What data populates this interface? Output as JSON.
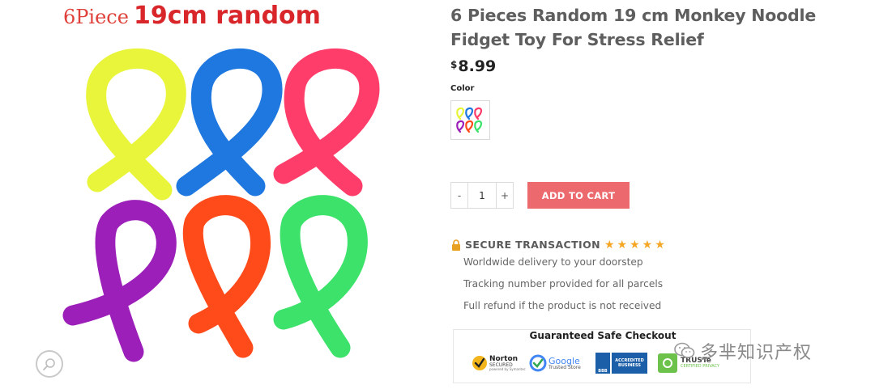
{
  "image": {
    "caption_count": "6Piece",
    "caption_size": "19cm random",
    "noodle_colors": [
      "#e8f53a",
      "#1f78e0",
      "#ff3d6a",
      "#9b1fb8",
      "#ff4a1a",
      "#3ce26a"
    ]
  },
  "product": {
    "title": "6 Pieces Random 19 cm Monkey Noodle Fidget Toy For Stress Relief",
    "currency": "$",
    "price": "8.99",
    "color_label": "Color"
  },
  "cart": {
    "minus": "-",
    "quantity": "1",
    "plus": "+",
    "add_label": "ADD TO CART"
  },
  "secure": {
    "label": "SECURE TRANSACTION",
    "stars": 5,
    "features": [
      "Worldwide delivery to your doorstep",
      "Tracking number provided for all parcels",
      "Full refund if the product is not received"
    ]
  },
  "checkout": {
    "title": "Guaranteed Safe Checkout",
    "norton_line1": "Norton",
    "norton_line2": "SECURED",
    "norton_line3": "powered by Symantec",
    "google_line1": "Google",
    "google_line2": "Trusted Store",
    "bbb_line1": "ACCREDITED",
    "bbb_line2": "BUSINESS",
    "bbb_logo": "BBB",
    "truste_line1": "TRUSTe",
    "truste_line2": "CERTIFIED PRIVACY"
  },
  "watermark": {
    "text": "多芈知识产权"
  },
  "colors": {
    "accent": "#ec6a6e",
    "star": "#f5a623",
    "title": "#5e5e5e"
  }
}
